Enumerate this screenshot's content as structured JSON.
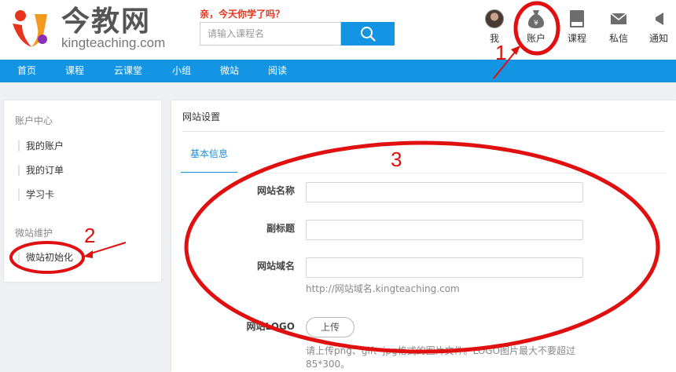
{
  "header": {
    "logo_cn": "今教网",
    "logo_en": "kingteaching.com",
    "slogan": "亲，今天你学了吗？",
    "search_placeholder": "请输入课程名"
  },
  "top_nav": [
    {
      "label": "我",
      "icon": "user-avatar"
    },
    {
      "label": "账户",
      "icon": "money-bag-icon"
    },
    {
      "label": "课程",
      "icon": "book-icon"
    },
    {
      "label": "私信",
      "icon": "envelope-icon"
    },
    {
      "label": "通知",
      "icon": "speaker-icon"
    }
  ],
  "nav": [
    "首页",
    "课程",
    "云课堂",
    "小组",
    "微站",
    "阅读"
  ],
  "sidebar": {
    "section1_title": "账户中心",
    "section1_items": [
      "我的账户",
      "我的订单",
      "学习卡"
    ],
    "section2_title": "微站维护",
    "section2_items": [
      "微站初始化"
    ]
  },
  "main": {
    "title": "网站设置",
    "tab": "基本信息",
    "fields": {
      "site_name_label": "网站名称",
      "subtitle_label": "副标题",
      "domain_label": "网站域名",
      "domain_hint": "http://网站域名.kingteaching.com",
      "logo_label": "网站LOGO",
      "upload_label": "上传",
      "logo_hint_line1": "请上传png、gif、jpg格式的图片文件。LOGO图片最大不要超过",
      "logo_hint_line2": "85*300。"
    }
  },
  "annotations": [
    "1",
    "2",
    "3"
  ],
  "colors": {
    "brand_blue": "#1495e3",
    "annotation_red": "#e01010",
    "slogan_red": "#e8341c"
  }
}
